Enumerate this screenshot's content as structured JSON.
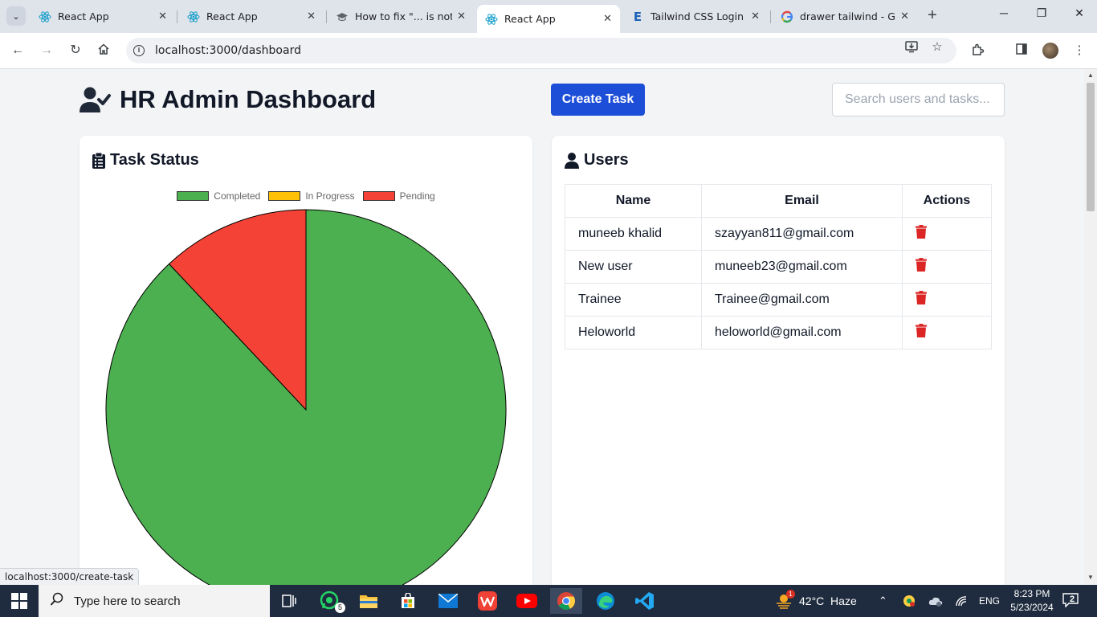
{
  "browser": {
    "tabs": [
      {
        "title": "React App",
        "favicon": "react-icon"
      },
      {
        "title": "React App",
        "favicon": "react-icon"
      },
      {
        "title": "How to fix \"... is not a",
        "favicon": "graduation-cap-icon"
      },
      {
        "title": "React App",
        "favicon": "react-icon",
        "active": true
      },
      {
        "title": "Tailwind CSS Login / S",
        "favicon": "tailwind-e-icon"
      },
      {
        "title": "drawer tailwind - Goo",
        "favicon": "google-icon"
      }
    ],
    "url": "localhost:3000/dashboard",
    "status_url": "localhost:3000/create-task"
  },
  "header": {
    "title": "HR Admin Dashboard",
    "create_task_label": "Create Task",
    "search_placeholder": "Search users and tasks..."
  },
  "task_status": {
    "title": "Task Status",
    "legend": [
      {
        "label": "Completed",
        "color": "#4caf50"
      },
      {
        "label": "In Progress",
        "color": "#ffc107"
      },
      {
        "label": "Pending",
        "color": "#f44336"
      }
    ]
  },
  "chart_data": {
    "type": "pie",
    "categories": [
      "Completed",
      "In Progress",
      "Pending"
    ],
    "values": [
      88,
      0,
      12
    ],
    "colors": [
      "#4caf50",
      "#ffc107",
      "#f44336"
    ],
    "legend": "top"
  },
  "users": {
    "title": "Users",
    "columns": [
      "Name",
      "Email",
      "Actions"
    ],
    "rows": [
      {
        "name": "muneeb khalid",
        "email": "szayyan811@gmail.com"
      },
      {
        "name": "New user",
        "email": "muneeb23@gmail.com"
      },
      {
        "name": "Trainee",
        "email": "Trainee@gmail.com"
      },
      {
        "name": "Heloworld",
        "email": "heloworld@gmail.com"
      }
    ]
  },
  "taskbar": {
    "search_placeholder": "Type here to search",
    "whatsapp_badge": "5",
    "weather": "42°C  Haze",
    "weather_badge": "1",
    "language": "ENG",
    "time": "8:23 PM",
    "date": "5/23/2024",
    "notifications": "2"
  }
}
